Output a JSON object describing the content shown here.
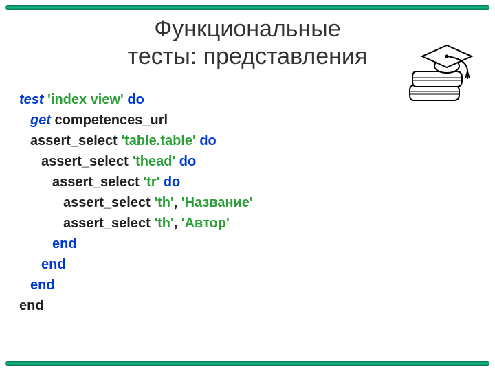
{
  "title_line1": "Функциональные",
  "title_line2": "тесты: представления",
  "code": {
    "l1a": "test",
    "l1b": " 'index view' ",
    "l1c": "do",
    "l2a": "get",
    "l2b": " competences_url",
    "l3a": "assert_select ",
    "l3b": "'table.table' ",
    "l3c": "do",
    "l4a": "assert_select ",
    "l4b": "'thead' ",
    "l4c": "do",
    "l5a": "assert_select ",
    "l5b": "'tr' ",
    "l5c": "do",
    "l6a": "assert_select ",
    "l6b": "'th'",
    "l6c": ", ",
    "l6d": "'Название'",
    "l7a": "assert_select ",
    "l7b": "'th'",
    "l7c": ", ",
    "l7d": "'Автор'",
    "end": "end"
  }
}
